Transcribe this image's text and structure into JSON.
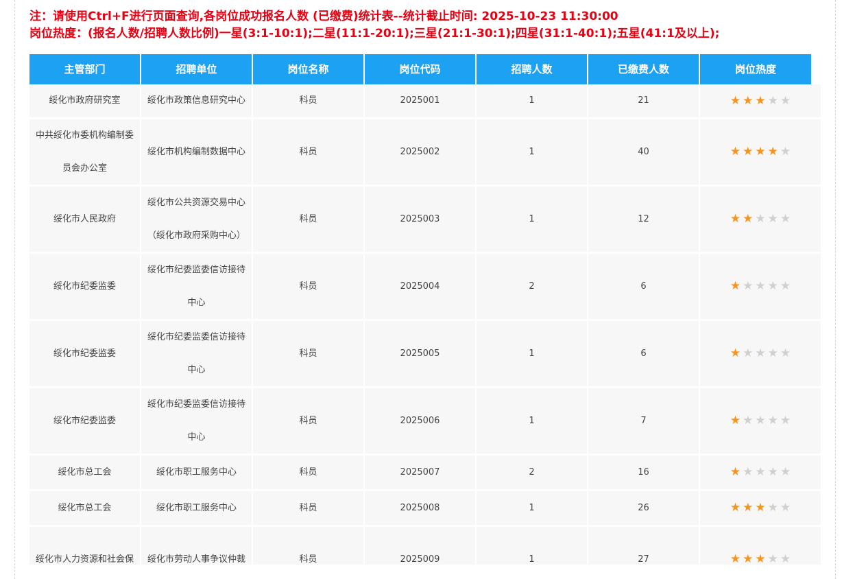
{
  "notice": {
    "line1": "注：请使用Ctrl+F进行页面查询,各岗位成功报名人数 (已缴费)统计表--统计截止时间: 2025-10-23 11:30:00",
    "line2": "岗位热度：(报名人数/招聘人数比例)一星(3:1-10:1);二星(11:1-20:1);三星(21:1-30:1);四星(31:1-40:1);五星(41:1及以上);"
  },
  "colors": {
    "accent": "#1da1f2",
    "notice": "#e60012",
    "star_on": "#f7941d",
    "star_off": "#d0d0d0",
    "row_bg": "#f7f7f7"
  },
  "table": {
    "headers": [
      "主管部门",
      "招聘单位",
      "岗位名称",
      "岗位代码",
      "招聘人数",
      "已缴费人数",
      "岗位热度"
    ],
    "star_icon": "star-icon",
    "max_stars": 5,
    "rows": [
      {
        "dept": "绥化市政府研究室",
        "unit": "绥化市政策信息研究中心",
        "post": "科员",
        "code": "2025001",
        "hire": "1",
        "paid": "21",
        "stars": 3
      },
      {
        "dept": "中共绥化市委机构编制委员会办公室",
        "unit": "绥化市机构编制数据中心",
        "post": "科员",
        "code": "2025002",
        "hire": "1",
        "paid": "40",
        "stars": 4
      },
      {
        "dept": "绥化市人民政府",
        "unit": "绥化市公共资源交易中心（绥化市政府采购中心）",
        "post": "科员",
        "code": "2025003",
        "hire": "1",
        "paid": "12",
        "stars": 2
      },
      {
        "dept": "绥化市纪委监委",
        "unit": "绥化市纪委监委信访接待中心",
        "post": "科员",
        "code": "2025004",
        "hire": "2",
        "paid": "6",
        "stars": 1
      },
      {
        "dept": "绥化市纪委监委",
        "unit": "绥化市纪委监委信访接待中心",
        "post": "科员",
        "code": "2025005",
        "hire": "1",
        "paid": "6",
        "stars": 1
      },
      {
        "dept": "绥化市纪委监委",
        "unit": "绥化市纪委监委信访接待中心",
        "post": "科员",
        "code": "2025006",
        "hire": "1",
        "paid": "7",
        "stars": 1
      },
      {
        "dept": "绥化市总工会",
        "unit": "绥化市职工服务中心",
        "post": "科员",
        "code": "2025007",
        "hire": "2",
        "paid": "16",
        "stars": 1
      },
      {
        "dept": "绥化市总工会",
        "unit": "绥化市职工服务中心",
        "post": "科员",
        "code": "2025008",
        "hire": "1",
        "paid": "26",
        "stars": 3
      },
      {
        "dept": "绥化市人力资源和社会保",
        "unit": "绥化市劳动人事争议仲裁",
        "post": "科员",
        "code": "2025009",
        "hire": "1",
        "paid": "27",
        "stars": 3
      }
    ]
  }
}
